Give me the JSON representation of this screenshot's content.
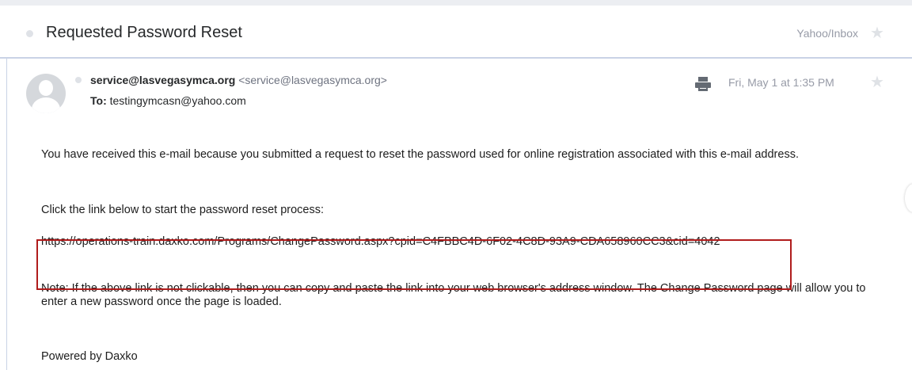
{
  "message": {
    "subject": "Requested Password Reset",
    "folder": "Yahoo/Inbox",
    "sender_name": "service@lasvegasymca.org",
    "sender_address": "<service@lasvegasymca.org>",
    "to_label": "To:",
    "to_address": "testingymcasn@yahoo.com",
    "date": "Fri, May 1 at 1:35 PM"
  },
  "body": {
    "p1": "You have received this e-mail because you submitted a request to reset the password used for online registration associated with this e-mail address.",
    "p2": "Click the link below to start the password reset process:",
    "link": "https://operations-train.daxko.com/Programs/ChangePassword.aspx?cpid=C4FBBC4D-6F02-4C8D-93A9-CDA658960CC3&cid=4042",
    "note": "Note: If the above link is not clickable, then you can copy and paste the link into your web browser's address window. The Change Password page will allow you to enter a new password once the page is loaded.",
    "footer": "Powered by Daxko"
  },
  "icons": {
    "subject_star": "star-icon",
    "message_star": "star-icon",
    "print": "print-icon",
    "avatar": "avatar-icon"
  },
  "colors": {
    "highlight_box": "#b01c1c",
    "divider": "#c9d3e6",
    "muted_text": "#979ba7"
  }
}
